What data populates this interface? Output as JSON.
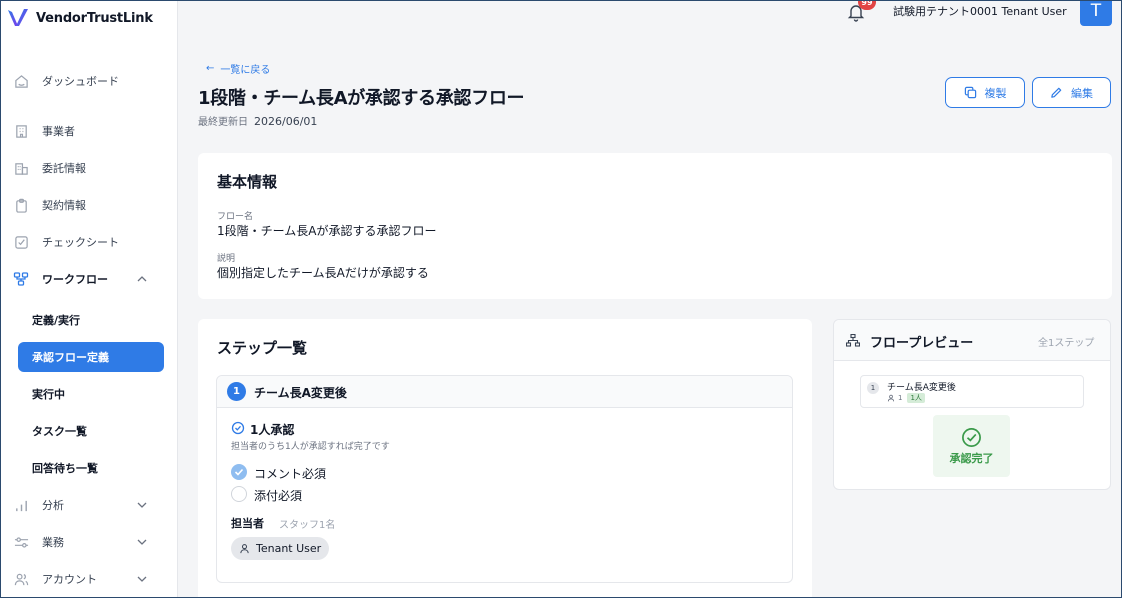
{
  "app": {
    "name": "VendorTrustLink"
  },
  "header": {
    "notification_count": "99",
    "tenant_user": "試験用テナント0001 Tenant User",
    "avatar_initial": "T"
  },
  "sidebar": {
    "items": [
      {
        "label": "ダッシュボード",
        "icon": "home-icon"
      },
      {
        "label": "事業者",
        "icon": "building-icon"
      },
      {
        "label": "委託情報",
        "icon": "office-icon"
      },
      {
        "label": "契約情報",
        "icon": "clipboard-icon"
      },
      {
        "label": "チェックシート",
        "icon": "checkbox-icon"
      },
      {
        "label": "ワークフロー",
        "icon": "workflow-icon",
        "expanded": true
      },
      {
        "label": "分析",
        "icon": "bar-chart-icon"
      },
      {
        "label": "業務",
        "icon": "sliders-icon"
      },
      {
        "label": "アカウント",
        "icon": "users-icon"
      }
    ],
    "workflow_sub": [
      {
        "label": "定義/実行",
        "active": false
      },
      {
        "label": "承認フロー定義",
        "active": true
      },
      {
        "label": "実行中",
        "active": false
      },
      {
        "label": "タスク一覧",
        "active": false
      },
      {
        "label": "回答待ち一覧",
        "active": false
      }
    ]
  },
  "page": {
    "back_label": "一覧に戻る",
    "title": "1段階・チーム長Aが承認する承認フロー",
    "updated_label": "最終更新日",
    "updated_value": "2026/06/01",
    "copy_button": "複製",
    "edit_button": "編集"
  },
  "basic_info": {
    "title": "基本情報",
    "flow_name_label": "フロー名",
    "flow_name": "1段階・チーム長Aが承認する承認フロー",
    "description_label": "説明",
    "description": "個別指定したチーム長Aだけが承認する"
  },
  "steps": {
    "title": "ステップ一覧",
    "items": [
      {
        "number": "1",
        "name": "チーム長A変更後",
        "approval_type": "1人承認",
        "approval_desc": "担当者のうち1人が承認すれば完了です",
        "comment_required_label": "コメント必須",
        "comment_required": true,
        "attachment_required_label": "添付必須",
        "attachment_required": false,
        "assignee_label": "担当者",
        "assignee_summary": "スタッフ1名",
        "assignees": [
          "Tenant User"
        ]
      }
    ]
  },
  "preview": {
    "title": "フロープレビュー",
    "step_count": "全1ステップ",
    "node_number": "1",
    "node_name": "チーム長A変更後",
    "node_count": "1",
    "node_badge": "1人",
    "complete_label": "承認完了"
  },
  "colors": {
    "primary": "#2f7be6",
    "success": "#3a9a4a",
    "badge": "#e24444"
  }
}
